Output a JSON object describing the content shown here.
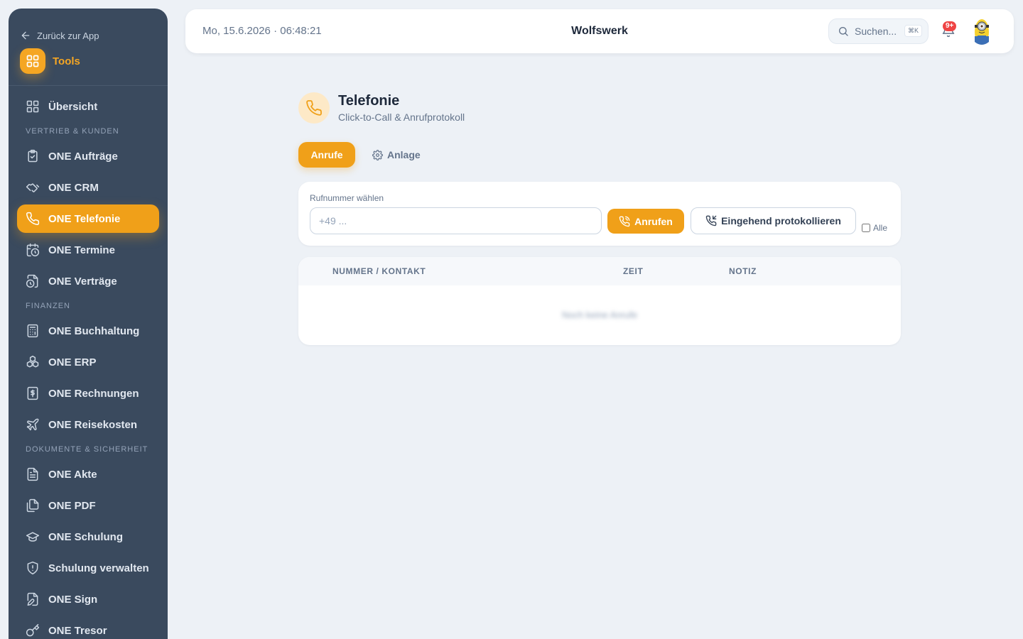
{
  "sidebar": {
    "back_label": "Zurück zur App",
    "brand_label": "Tools",
    "items": {
      "overview": "Übersicht",
      "section_sales": "VERTRIEB & KUNDEN",
      "orders": "ONE Aufträge",
      "crm": "ONE CRM",
      "telephony": "ONE Telefonie",
      "appointments": "ONE Termine",
      "contracts": "ONE Verträge",
      "section_finance": "FINANZEN",
      "accounting": "ONE Buchhaltung",
      "erp": "ONE ERP",
      "invoices": "ONE Rechnungen",
      "travel": "ONE Reisekosten",
      "section_docs": "DOKUMENTE & SICHERHEIT",
      "files": "ONE Akte",
      "pdf": "ONE PDF",
      "training": "ONE Schulung",
      "training_admin": "Schulung verwalten",
      "sign": "ONE Sign",
      "vault": "ONE Tresor"
    }
  },
  "topbar": {
    "datetime": "Mo, 15.6.2026 · 06:48:21",
    "title": "Wolfswerk",
    "search_placeholder": "Suchen...",
    "search_shortcut": "⌘K",
    "notifications_badge": "9+"
  },
  "page": {
    "title": "Telefonie",
    "subtitle": "Click-to-Call & Anrufprotokoll",
    "tabs": {
      "calls": "Anrufe",
      "system": "Anlage"
    }
  },
  "dialer": {
    "label": "Rufnummer wählen",
    "placeholder": "+49 ...",
    "call_button": "Anrufen",
    "log_incoming_button": "Eingehend protokollieren",
    "all_label": "Alle"
  },
  "table": {
    "columns": [
      "NUMMER / KONTAKT",
      "ZEIT",
      "NOTIZ"
    ],
    "empty_message": "Noch keine Anrufe"
  },
  "colors": {
    "accent": "#f0a019",
    "sidebar_bg": "#3a4a5e",
    "page_bg": "#edf1f6",
    "badge": "#ef4444"
  }
}
